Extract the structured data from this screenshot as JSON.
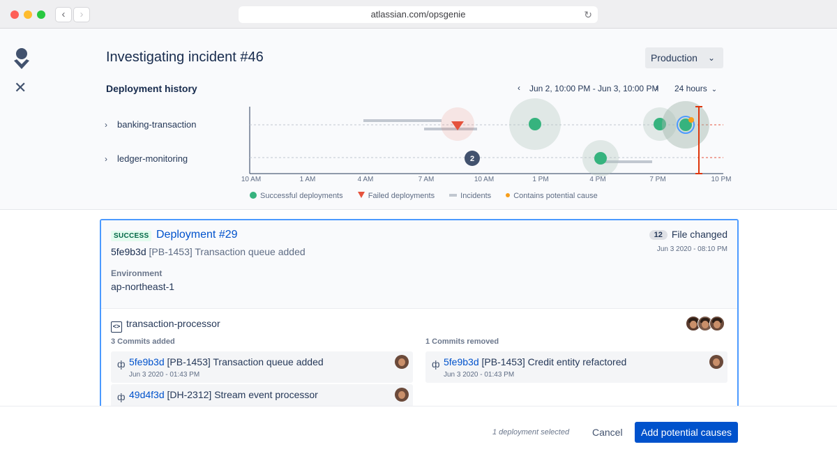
{
  "browser": {
    "url": "atlassian.com/opsgenie"
  },
  "header": {
    "title": "Investigating incident #46",
    "environment": "Production"
  },
  "history": {
    "title": "Deployment history",
    "range": "Jun 2, 10:00 PM - Jun 3, 10:00 PM",
    "period": "24 hours",
    "services": [
      "banking-transaction",
      "ledger-monitoring"
    ],
    "axis_labels": [
      "10 AM",
      "1 AM",
      "4 AM",
      "7 AM",
      "10 AM",
      "1 PM",
      "4 PM",
      "7 PM",
      "10 PM"
    ],
    "legend": {
      "success": "Successful deployments",
      "failed": "Failed deployments",
      "incidents": "Incidents",
      "cause": "Contains potential cause"
    },
    "cluster_count": "2",
    "colors": {
      "success": "#36b37e",
      "failed": "#e5533d",
      "incident": "#c1c7d0",
      "cause": "#f79e1b",
      "marker": "#de350b",
      "selected": "#4c9aff"
    }
  },
  "deployment": {
    "status": "SUCCESS",
    "title": "Deployment #29",
    "files_count": "12",
    "files_label": "File changed",
    "date": "Jun 3 2020 - 08:10 PM",
    "commit_hash": "5fe9b3d",
    "commit_message": "[PB-1453] Transaction queue added",
    "environment_label": "Environment",
    "environment_value": "ap-northeast-1",
    "repo": "transaction-processor",
    "added_title": "3 Commits added",
    "removed_title": "1 Commits removed",
    "added": [
      {
        "hash": "5fe9b3d",
        "message": "[PB-1453] Transaction queue added",
        "date": "Jun 3 2020 - 01:43 PM"
      },
      {
        "hash": "49d4f3d",
        "message": "[DH-2312] Stream event processor",
        "date": ""
      }
    ],
    "removed": [
      {
        "hash": "5fe9b3d",
        "message": "[PB-1453] Credit entity refactored",
        "date": "Jun 3 2020 - 01:43 PM"
      }
    ]
  },
  "footer": {
    "note": "1 deployment selected",
    "cancel": "Cancel",
    "primary": "Add potential causes"
  }
}
